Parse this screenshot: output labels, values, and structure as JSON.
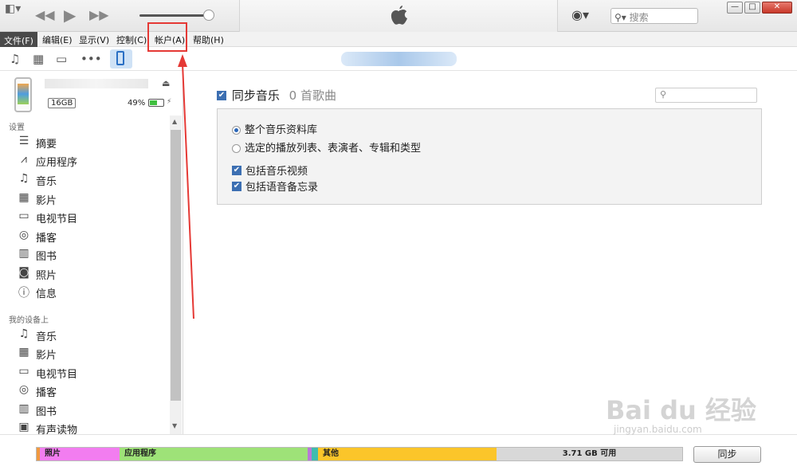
{
  "titlebar": {
    "search_placeholder": "搜索",
    "apple_logo": "apple-logo",
    "window_buttons": [
      "—",
      "□",
      "✕"
    ]
  },
  "menubar": {
    "items": [
      "文件(F)",
      "编辑(E)",
      "显示(V)",
      "控制(C)",
      "帐户(A)",
      "帮助(H)"
    ]
  },
  "device": {
    "capacity": "16GB",
    "battery": "49%"
  },
  "sidebar": {
    "settings_header": "设置",
    "settings_items": [
      "摘要",
      "应用程序",
      "音乐",
      "影片",
      "电视节目",
      "播客",
      "图书",
      "照片",
      "信息"
    ],
    "on_device_header": "我的设备上",
    "device_items": [
      "音乐",
      "影片",
      "电视节目",
      "播客",
      "图书",
      "有声读物"
    ]
  },
  "main": {
    "sync_title": "同步音乐",
    "song_count": "0 首歌曲",
    "radio_all": "整个音乐资料库",
    "radio_selected": "选定的播放列表、表演者、专辑和类型",
    "include_videos": "包括音乐视频",
    "include_memos": "包括语音备忘录"
  },
  "storage": {
    "photos": "照片",
    "apps": "应用程序",
    "other": "其他",
    "free": "3.71 GB 可用",
    "colors": {
      "photos": "#f27df0",
      "apps": "#9ee278",
      "other": "#fbc52a",
      "free": "#d8d8d8"
    }
  },
  "sync_button": "同步",
  "watermark": {
    "main": "Bai du 经验",
    "sub": "jingyan.baidu.com"
  }
}
